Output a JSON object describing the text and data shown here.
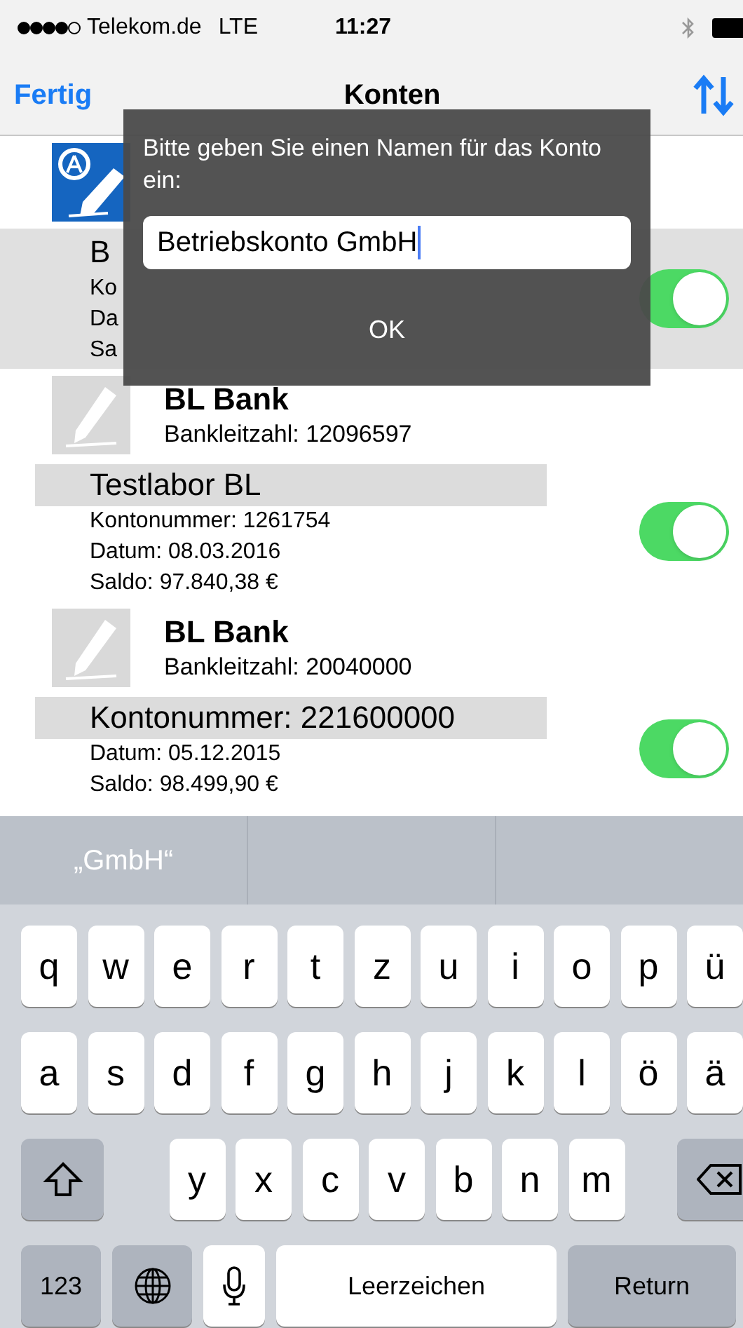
{
  "status_bar": {
    "carrier": "Telekom.de",
    "network": "LTE",
    "time": "11:27"
  },
  "nav_bar": {
    "back": "Fertig",
    "title": "Konten"
  },
  "banks": [
    {
      "kind": "brand",
      "accounts": [
        {
          "selected": true,
          "title": "B",
          "lines": [
            "Ko",
            "Da",
            "Sa"
          ],
          "on": true
        }
      ]
    },
    {
      "kind": "placeholder",
      "name": "BL Bank",
      "code": "Bankleitzahl: 12096597",
      "accounts": [
        {
          "selected": false,
          "title": "Testlabor BL",
          "lines": [
            "Kontonummer: 1261754",
            "Datum: 08.03.2016",
            "Saldo: 97.840,38 €"
          ],
          "on": true
        }
      ]
    },
    {
      "kind": "placeholder",
      "name": "BL Bank",
      "code": "Bankleitzahl: 20040000",
      "accounts": [
        {
          "selected": false,
          "title": "Kontonummer: 221600000",
          "lines": [
            "Datum: 05.12.2015",
            "Saldo: 98.499,90 €"
          ],
          "on": true
        }
      ]
    }
  ],
  "dialog": {
    "message": "Bitte geben Sie einen Namen für das Konto ein:",
    "value": "Betriebskonto GmbH",
    "button": "OK"
  },
  "keyboard": {
    "suggestions": [
      "„GmbH“"
    ],
    "rows": [
      [
        "q",
        "w",
        "e",
        "r",
        "t",
        "z",
        "u",
        "i",
        "o",
        "p",
        "ü"
      ],
      [
        "a",
        "s",
        "d",
        "f",
        "g",
        "h",
        "j",
        "k",
        "l",
        "ö",
        "ä"
      ],
      [
        "y",
        "x",
        "c",
        "v",
        "b",
        "n",
        "m"
      ]
    ],
    "numbers": "123",
    "space": "Leerzeichen",
    "return": "Return"
  }
}
